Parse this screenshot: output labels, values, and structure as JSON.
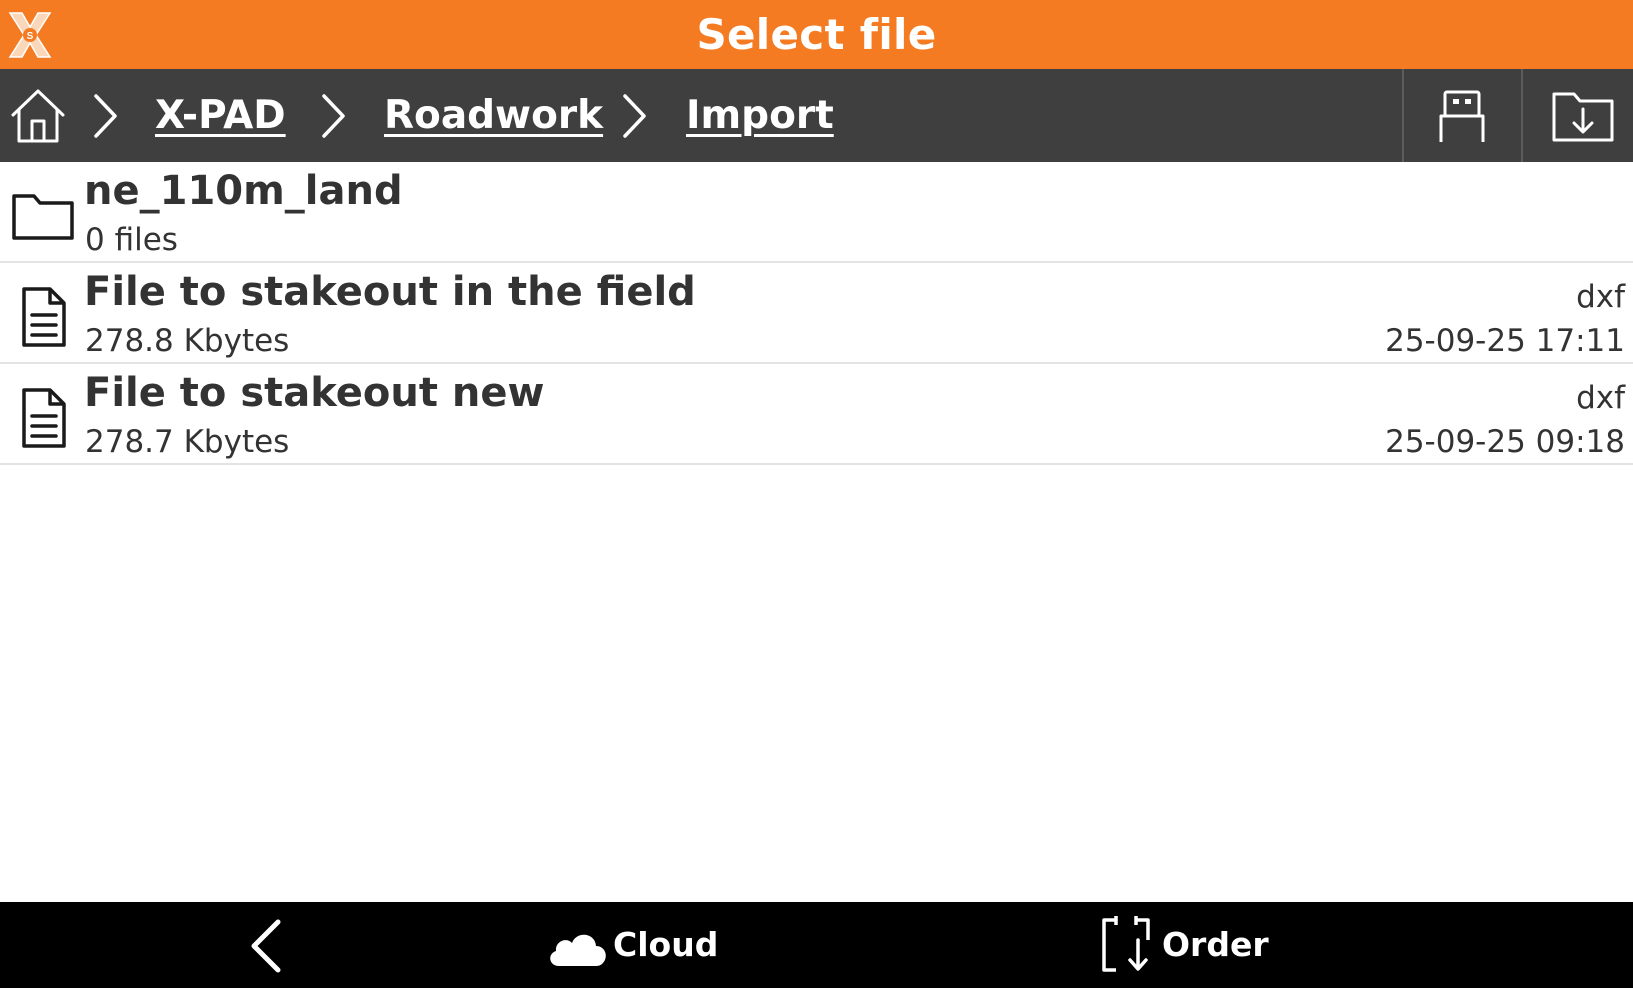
{
  "title_bar": {
    "title": "Select file",
    "logo_icon": "xpad-logo-icon",
    "background": "#f47b22"
  },
  "breadcrumb": {
    "home_icon": "home-icon",
    "separator_icon": "chevron-right-icon",
    "items": [
      {
        "label": "X-PAD"
      },
      {
        "label": "Roadwork"
      },
      {
        "label": "Import"
      }
    ],
    "actions": [
      {
        "icon": "usb-drive-icon"
      },
      {
        "icon": "folder-download-icon"
      }
    ],
    "background": "#3f3f3f"
  },
  "files": [
    {
      "type": "folder",
      "icon": "folder-icon",
      "name": "ne_110m_land",
      "subtitle": "0 files",
      "ext": "",
      "date": ""
    },
    {
      "type": "file",
      "icon": "document-icon",
      "name": "File to stakeout in the field",
      "subtitle": "278.8 Kbytes",
      "ext": "dxf",
      "date": "25-09-25 17:11"
    },
    {
      "type": "file",
      "icon": "document-icon",
      "name": "File to stakeout new",
      "subtitle": "278.7 Kbytes",
      "ext": "dxf",
      "date": "25-09-25 09:18"
    }
  ],
  "bottom_bar": {
    "back_icon": "back-arrow-icon",
    "cloud_label": "Cloud",
    "cloud_icon": "cloud-icon",
    "order_label": "Order",
    "order_icon": "sort-order-icon",
    "background": "#000000"
  }
}
